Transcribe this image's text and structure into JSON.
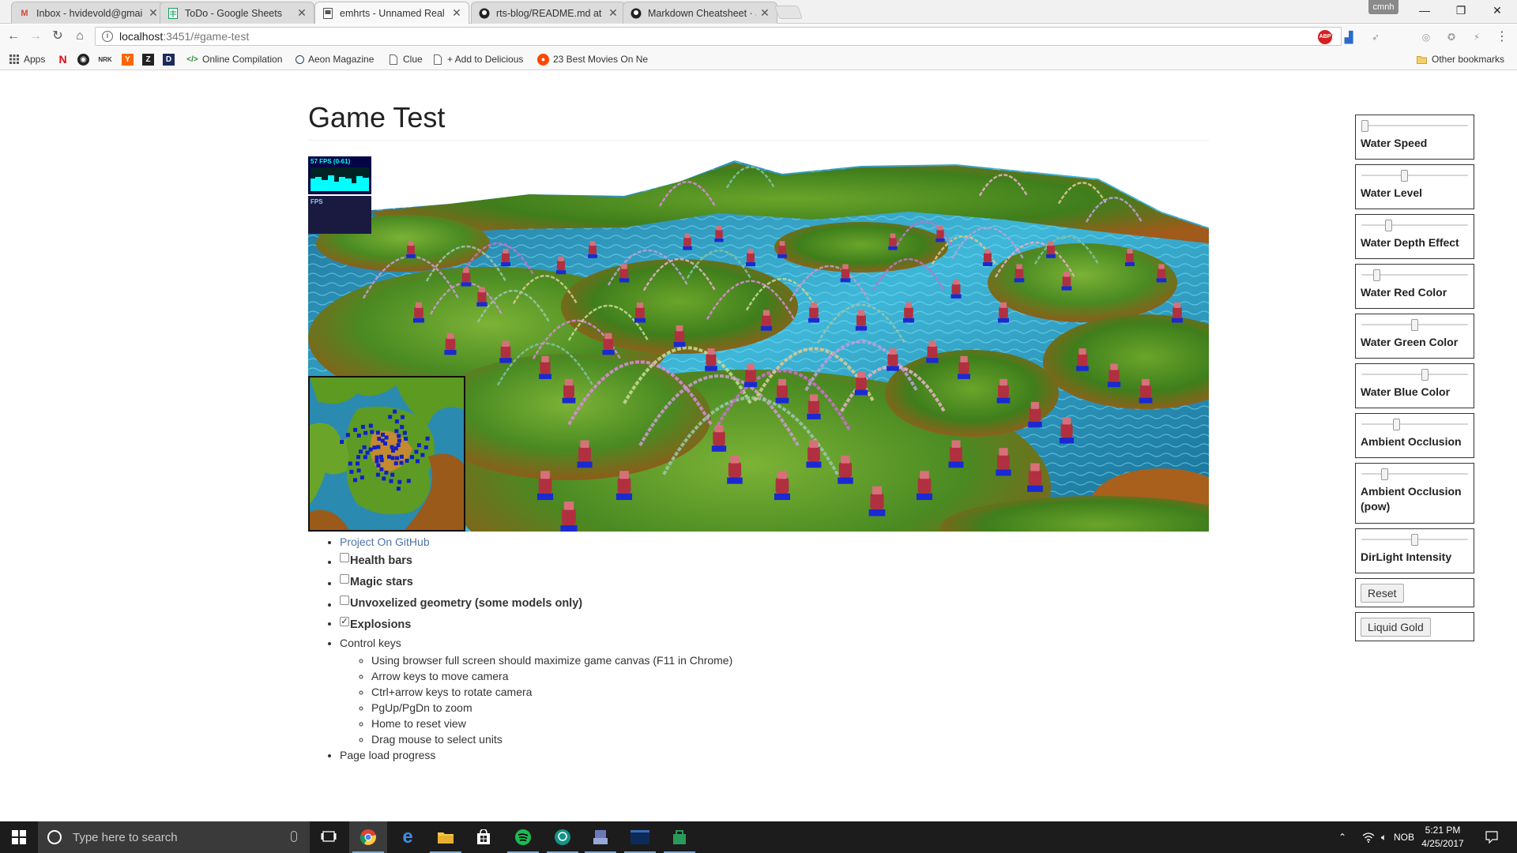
{
  "browser": {
    "tabs": [
      {
        "title": "Inbox - hvidevold@gmai",
        "icon": "gmail-icon",
        "active": false
      },
      {
        "title": "ToDo - Google Sheets",
        "icon": "sheets-icon",
        "active": false
      },
      {
        "title": "emhrts - Unnamed Real",
        "icon": "page-icon",
        "active": true
      },
      {
        "title": "rts-blog/README.md at",
        "icon": "github-icon",
        "active": false
      },
      {
        "title": "Markdown Cheatsheet · a",
        "icon": "github-icon",
        "active": false
      }
    ],
    "profile_name": "cmnh",
    "url_host": "localhost",
    "url_rest": ":3451/#game-test",
    "bookmarks": [
      {
        "label": "Apps",
        "icon": "apps-grid-icon"
      },
      {
        "label": "",
        "icon": "netflix-icon"
      },
      {
        "label": "",
        "icon": "steam-icon"
      },
      {
        "label": "",
        "icon": "nrk-icon"
      },
      {
        "label": "",
        "icon": "hackernews-icon"
      },
      {
        "label": "",
        "icon": "archive-icon"
      },
      {
        "label": "",
        "icon": "dictionary-icon"
      },
      {
        "label": "Online Compilation",
        "icon": "code-icon"
      },
      {
        "label": "Aeon Magazine",
        "icon": "aeon-icon"
      },
      {
        "label": "Clue",
        "icon": "page-icon"
      },
      {
        "label": "+ Add to Delicious",
        "icon": "page-icon"
      },
      {
        "label": "23 Best Movies On Ne",
        "icon": "reddit-icon"
      }
    ],
    "other_bookmarks": "Other bookmarks"
  },
  "page": {
    "title": "Game Test",
    "fps_label": "57 FPS (0-61)",
    "ms_label": "FPS",
    "github_link": "Project On GitHub",
    "options": [
      {
        "label": "Health bars",
        "checked": false
      },
      {
        "label": "Magic stars",
        "checked": false
      },
      {
        "label": "Unvoxelized geometry (some models only)",
        "checked": false
      },
      {
        "label": "Explosions",
        "checked": true
      }
    ],
    "control_keys_heading": "Control keys",
    "control_keys": [
      "Using browser full screen should maximize game canvas (F11 in Chrome)",
      "Arrow keys to move camera",
      "Ctrl+arrow keys to rotate camera",
      "PgUp/PgDn to zoom",
      "Home to reset view",
      "Drag mouse to select units"
    ],
    "load_progress": "Page load progress"
  },
  "controls": {
    "sliders": [
      {
        "label": "Water Speed",
        "value": 0.0
      },
      {
        "label": "Water Level",
        "value": 0.4
      },
      {
        "label": "Water Depth Effect",
        "value": 0.24
      },
      {
        "label": "Water Red Color",
        "value": 0.12
      },
      {
        "label": "Water Green Color",
        "value": 0.5
      },
      {
        "label": "Water Blue Color",
        "value": 0.6
      },
      {
        "label": "Ambient Occlusion",
        "value": 0.32
      },
      {
        "label": "Ambient Occlusion (pow)",
        "value": 0.2
      },
      {
        "label": "DirLight Intensity",
        "value": 0.5
      }
    ],
    "reset_label": "Reset",
    "liquid_gold_label": "Liquid Gold"
  },
  "taskbar": {
    "search_placeholder": "Type here to search",
    "language": "NOB",
    "time": "5:21 PM",
    "date": "4/25/2017"
  },
  "colors": {
    "link": "#4f72a8",
    "water": "#2fa6c9",
    "terrain_green": "#4e8a1e",
    "terrain_orange": "#a9601c",
    "unit_red": "#b03040",
    "unit_blue": "#1a2ad0"
  }
}
